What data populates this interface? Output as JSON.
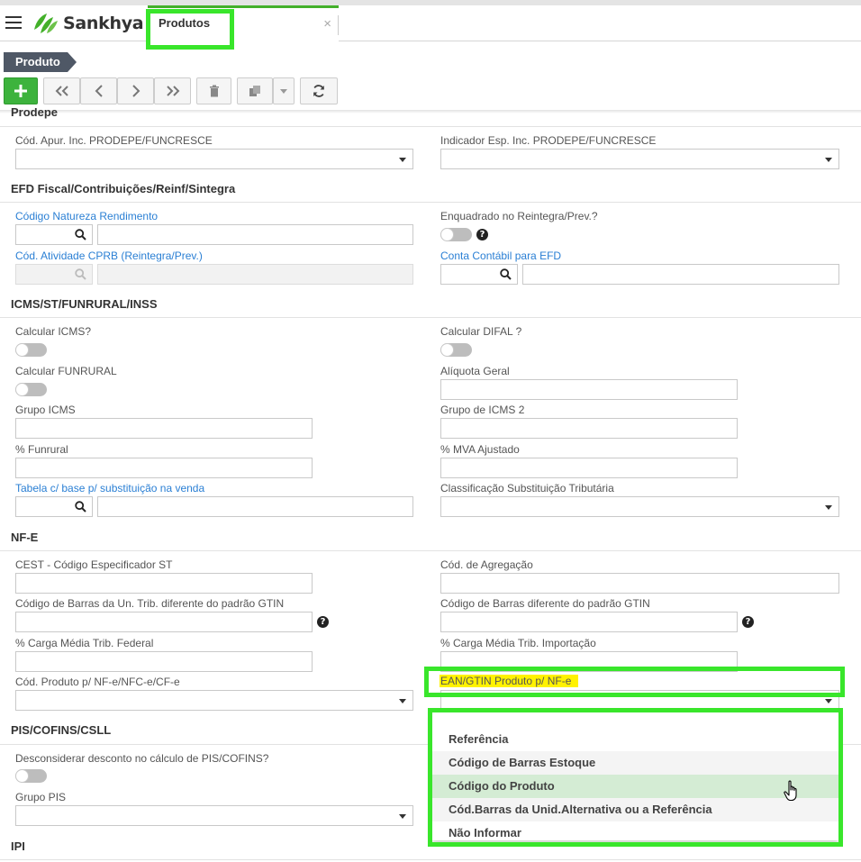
{
  "app": {
    "brand": "Sankhya",
    "tab_label": "Produtos",
    "tab_close": "×"
  },
  "breadcrumb": "Produto",
  "toolbar": {
    "add": "+",
    "icons": [
      "add-icon",
      "first-record-icon",
      "previous-record-icon",
      "next-record-icon",
      "last-record-icon",
      "delete-icon",
      "copy-icon",
      "chevron-down-icon",
      "refresh-icon"
    ]
  },
  "sections": {
    "prodepe": "Prodepe",
    "efd": "EFD Fiscal/Contribuições/Reinf/Sintegra",
    "icms": "ICMS/ST/FUNRURAL/INSS",
    "nfe": "NF-E",
    "pis": "PIS/COFINS/CSLL",
    "ipi": "IPI"
  },
  "fields": {
    "cod_apur": "Cód. Apur. Inc. PRODEPE/FUNCRESCE",
    "indicador_esp": "Indicador Esp. Inc. PRODEPE/FUNCRESCE",
    "codigo_natureza": "Código Natureza Rendimento",
    "enquadrado_reintegra": "Enquadrado no Reintegra/Prev.?",
    "cod_atividade_cprb": "Cód. Atividade CPRB (Reintegra/Prev.)",
    "conta_contabil_efd": "Conta Contábil para EFD",
    "calcular_icms": "Calcular ICMS?",
    "calcular_difal": "Calcular DIFAL ?",
    "calcular_funrural": "Calcular FUNRURAL",
    "aliquota_geral": "Alíquota Geral",
    "grupo_icms": "Grupo ICMS",
    "grupo_icms2": "Grupo de ICMS 2",
    "pct_funrural": "% Funrural",
    "pct_mva": "% MVA Ajustado",
    "tabela_base_st": "Tabela c/ base p/ substituição na venda",
    "classificacao_st": "Classificação Substituição Tributária",
    "cest": "CEST - Código Especificador ST",
    "cod_agregacao": "Cód. de Agregação",
    "cod_barras_un_trib": "Código de Barras da Un. Trib. diferente do padrão GTIN",
    "cod_barras_gtin": "Código de Barras diferente do padrão GTIN",
    "carga_federal": "% Carga Média Trib. Federal",
    "carga_importacao": "% Carga Média Trib. Importação",
    "cod_produto_nfe": "Cód. Produto p/ NF-e/NFC-e/CF-e",
    "ean_gtin_nfe": "EAN/GTIN Produto p/ NF-e",
    "desconsiderar_desconto": "Desconsiderar desconto no cálculo de PIS/COFINS?",
    "grupo_pis": "Grupo PIS"
  },
  "help_glyph": "?",
  "dropdown": {
    "options": [
      "Referência",
      "Código de Barras Estoque",
      "Código do Produto",
      "Cód.Barras da Unid.Alternativa ou a Referência",
      "Não Informar"
    ],
    "hovered": "Código do Produto"
  },
  "colors": {
    "brand_green": "#43b02a",
    "highlight_green": "#39e62b",
    "link_blue": "#2a7fd4",
    "highlight_yellow": "#fff200",
    "hover_option": "#d4ecd4"
  }
}
